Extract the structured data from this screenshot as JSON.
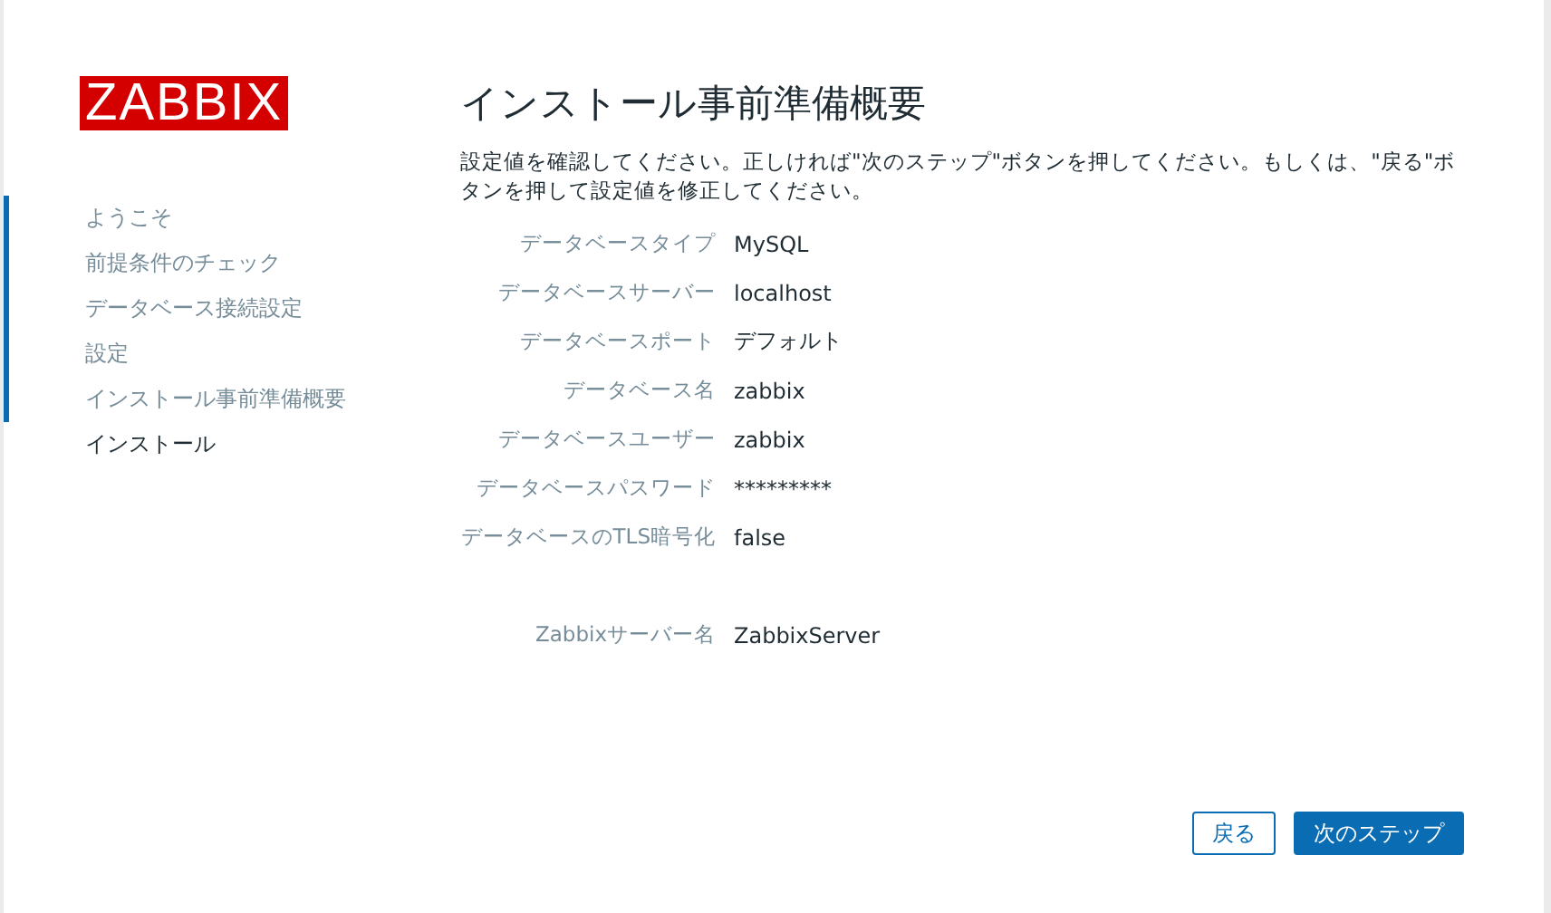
{
  "logo": "ZABBIX",
  "steps": [
    {
      "label": "ようこそ",
      "completed": true,
      "selected": false
    },
    {
      "label": "前提条件のチェック",
      "completed": true,
      "selected": false
    },
    {
      "label": "データベース接続設定",
      "completed": true,
      "selected": false
    },
    {
      "label": "設定",
      "completed": true,
      "selected": false
    },
    {
      "label": "インストール事前準備概要",
      "completed": true,
      "selected": false
    },
    {
      "label": "インストール",
      "completed": false,
      "selected": true
    }
  ],
  "title": "インストール事前準備概要",
  "description": "設定値を確認してください。正しければ\"次のステップ\"ボタンを押してください。もしくは、\"戻る\"ボタンを押して設定値を修正してください。",
  "sections": [
    {
      "rows": [
        {
          "label": "データベースタイプ",
          "value": "MySQL"
        },
        {
          "label": "データベースサーバー",
          "value": "localhost"
        },
        {
          "label": "データベースポート",
          "value": "デフォルト"
        },
        {
          "label": "データベース名",
          "value": "zabbix"
        },
        {
          "label": "データベースユーザー",
          "value": "zabbix"
        },
        {
          "label": "データベースパスワード",
          "value": "*********"
        },
        {
          "label": "データベースのTLS暗号化",
          "value": "false"
        }
      ]
    },
    {
      "rows": [
        {
          "label": "Zabbixサーバー名",
          "value": "ZabbixServer"
        }
      ]
    }
  ],
  "buttons": [
    {
      "label": "戻る",
      "kind": "secondary"
    },
    {
      "label": "次のステップ",
      "kind": "primary"
    }
  ]
}
